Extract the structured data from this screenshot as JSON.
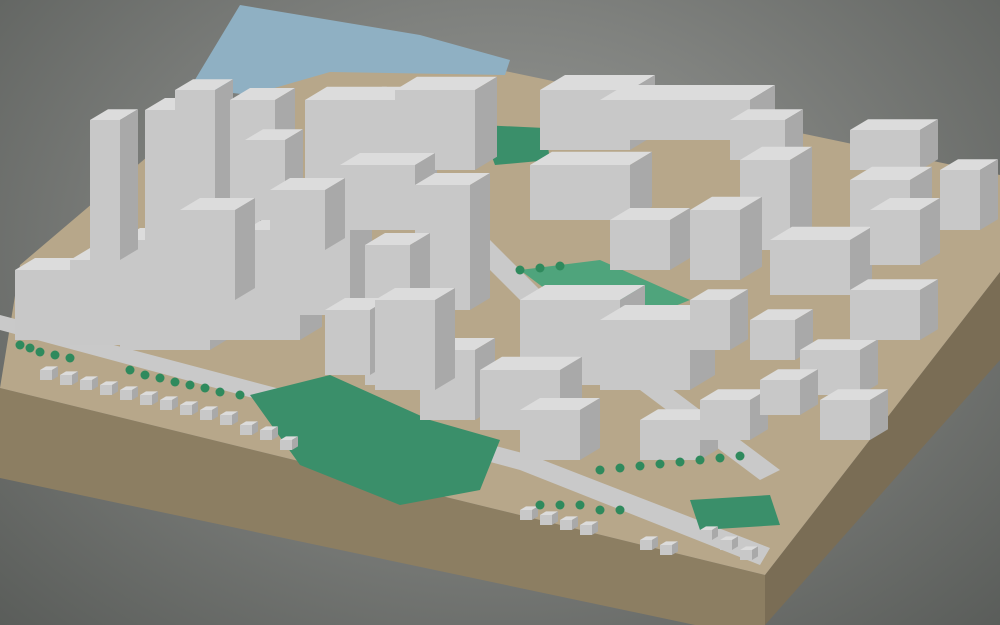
{
  "scene": {
    "kind": "3d-city-block-model",
    "colors": {
      "background": "#7f817e",
      "base_front": "#8c7e62",
      "base_side": "#7a6d55",
      "ground": "#b7a78a",
      "water": "#8fb0c3",
      "park": "#3a8f6a",
      "park_light": "#4fa47c",
      "road": "#c9c9c9",
      "building": "#c8c8c8",
      "building_light": "#dcdcdc",
      "building_dark": "#a9a9a9",
      "tree": "#2f8a5d"
    }
  }
}
